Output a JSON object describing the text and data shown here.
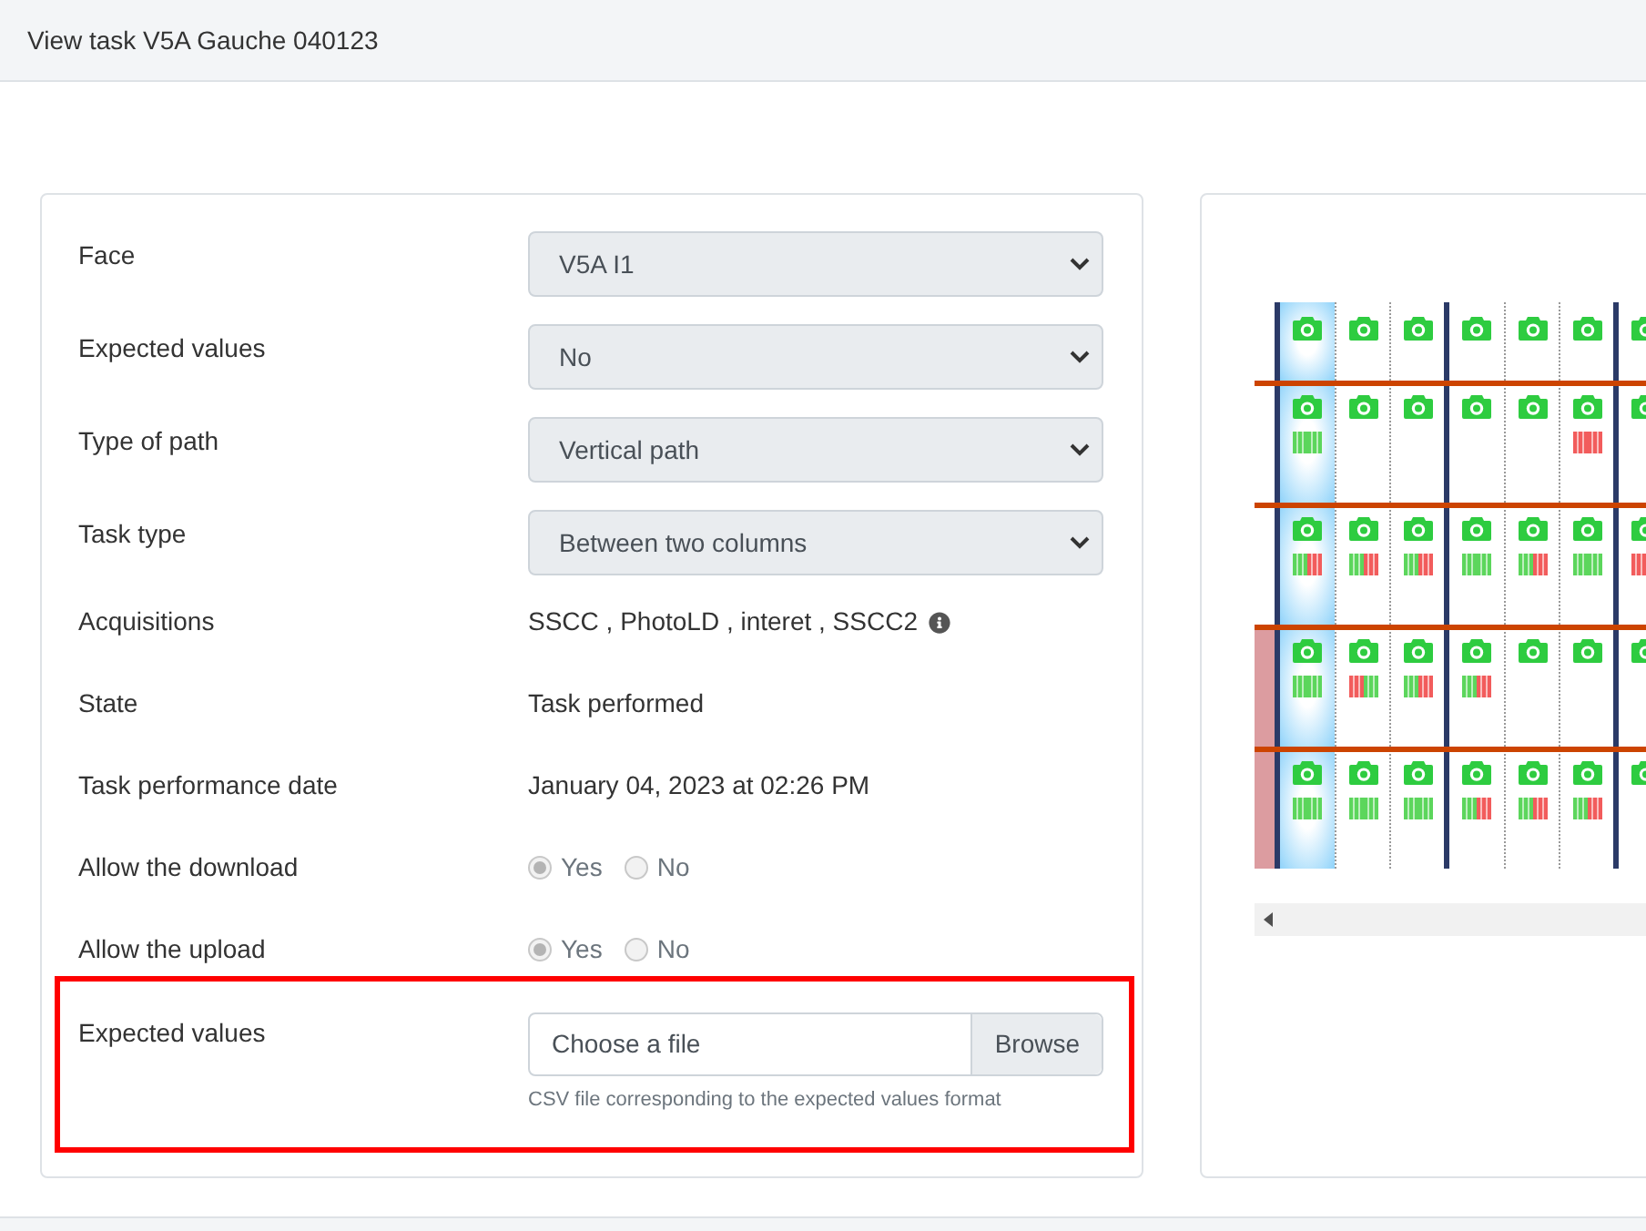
{
  "header": {
    "title": "View task V5A Gauche 040123"
  },
  "form": {
    "rows": [
      {
        "kind": "select",
        "label": "Face",
        "value": "V5A I1"
      },
      {
        "kind": "select",
        "label": "Expected values",
        "value": "No"
      },
      {
        "kind": "select",
        "label": "Type of path",
        "value": "Vertical path"
      },
      {
        "kind": "select",
        "label": "Task type",
        "value": "Between two columns"
      },
      {
        "kind": "text",
        "label": "Acquisitions",
        "value": "SSCC , PhotoLD , interet , SSCC2",
        "info": true
      },
      {
        "kind": "text",
        "label": "State",
        "value": "Task performed",
        "info": false
      },
      {
        "kind": "text",
        "label": "Task performance date",
        "value": "January 04, 2023 at 02:26 PM",
        "info": false
      },
      {
        "kind": "radio",
        "label": "Allow the download",
        "disabled": true,
        "options": [
          {
            "label": "Yes",
            "selected": true
          },
          {
            "label": "No",
            "selected": false
          }
        ]
      },
      {
        "kind": "radio",
        "label": "Allow the upload",
        "disabled": true,
        "options": [
          {
            "label": "Yes",
            "selected": true
          },
          {
            "label": "No",
            "selected": false
          }
        ]
      },
      {
        "kind": "file",
        "label": "Expected values",
        "placeholder": "Choose a file",
        "button": "Browse",
        "help": "CSV file corresponding to the expected values format",
        "highlighted": true
      }
    ]
  },
  "rack": {
    "rows": [
      {
        "flagged": false,
        "cells": [
          {
            "selected": true
          },
          {
            "selected": false
          },
          {
            "selected": false
          },
          {
            "selected": false
          },
          {
            "selected": false
          },
          {
            "selected": false
          },
          {
            "selected": false
          }
        ]
      },
      {
        "flagged": false,
        "cells": [
          {
            "selected": true,
            "barcode": [
              {
                "color": "#5cd65c"
              },
              {
                "color": "#5cd65c"
              }
            ]
          },
          {
            "selected": false
          },
          {
            "selected": false
          },
          {
            "selected": false
          },
          {
            "selected": false
          },
          {
            "selected": false,
            "barcode": [
              {
                "color": "#f25c5c"
              },
              {
                "color": "#f25c5c"
              }
            ]
          },
          {
            "selected": false
          }
        ]
      },
      {
        "flagged": false,
        "cells": [
          {
            "selected": true,
            "barcode": [
              {
                "color": "#5cd65c"
              },
              {
                "color": "#f25c5c"
              }
            ]
          },
          {
            "selected": false,
            "barcode": [
              {
                "color": "#5cd65c"
              },
              {
                "color": "#f25c5c"
              }
            ]
          },
          {
            "selected": false,
            "barcode": [
              {
                "color": "#5cd65c"
              },
              {
                "color": "#f25c5c"
              }
            ]
          },
          {
            "selected": false,
            "barcode": [
              {
                "color": "#5cd65c"
              },
              {
                "color": "#5cd65c"
              }
            ]
          },
          {
            "selected": false,
            "barcode": [
              {
                "color": "#5cd65c"
              },
              {
                "color": "#f25c5c"
              }
            ]
          },
          {
            "selected": false,
            "barcode": [
              {
                "color": "#5cd65c"
              },
              {
                "color": "#5cd65c"
              }
            ]
          },
          {
            "selected": false,
            "barcode": [
              {
                "color": "#f25c5c"
              }
            ]
          }
        ]
      },
      {
        "flagged": true,
        "cells": [
          {
            "selected": true,
            "barcode": [
              {
                "color": "#5cd65c"
              },
              {
                "color": "#5cd65c"
              }
            ]
          },
          {
            "selected": false,
            "barcode": [
              {
                "color": "#f25c5c"
              },
              {
                "color": "#5cd65c"
              }
            ]
          },
          {
            "selected": false,
            "barcode": [
              {
                "color": "#5cd65c"
              },
              {
                "color": "#f25c5c"
              }
            ]
          },
          {
            "selected": false,
            "barcode": [
              {
                "color": "#5cd65c"
              },
              {
                "color": "#f25c5c"
              }
            ]
          },
          {
            "selected": false
          },
          {
            "selected": false
          },
          {
            "selected": false
          }
        ]
      },
      {
        "flagged": true,
        "cells": [
          {
            "selected": true,
            "barcode": [
              {
                "color": "#5cd65c"
              },
              {
                "color": "#5cd65c"
              }
            ]
          },
          {
            "selected": false,
            "barcode": [
              {
                "color": "#5cd65c"
              },
              {
                "color": "#5cd65c"
              }
            ]
          },
          {
            "selected": false,
            "barcode": [
              {
                "color": "#5cd65c"
              },
              {
                "color": "#5cd65c"
              }
            ]
          },
          {
            "selected": false,
            "barcode": [
              {
                "color": "#5cd65c"
              },
              {
                "color": "#f25c5c"
              }
            ]
          },
          {
            "selected": false,
            "barcode": [
              {
                "color": "#5cd65c"
              },
              {
                "color": "#f25c5c"
              }
            ]
          },
          {
            "selected": false,
            "barcode": [
              {
                "color": "#5cd65c"
              },
              {
                "color": "#f25c5c"
              }
            ]
          },
          {
            "selected": false
          }
        ]
      }
    ]
  }
}
